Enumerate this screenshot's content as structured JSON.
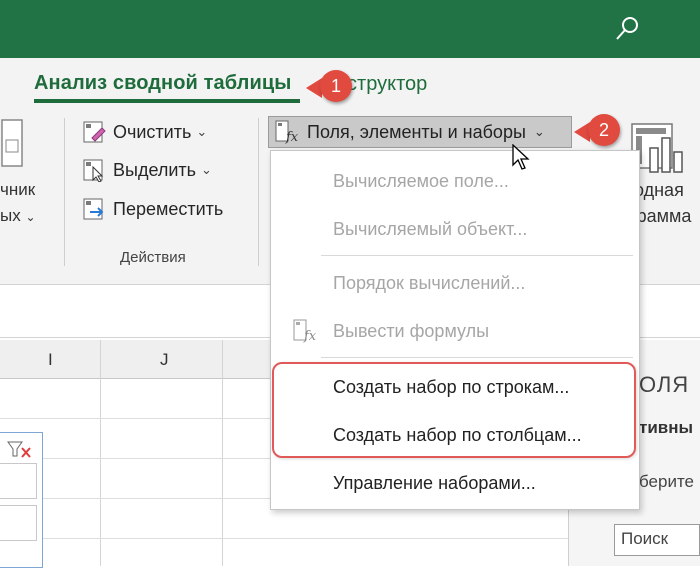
{
  "ribbon": {
    "tabs": [
      {
        "label": "Анализ сводной таблицы",
        "active": true
      },
      {
        "label": "нструктор",
        "active": false
      }
    ],
    "left_fragments": [
      "чник",
      "ых"
    ],
    "actions_group": {
      "label": "Действия",
      "buttons": [
        {
          "label": "Очистить",
          "icon": "clear-icon",
          "has_menu": true
        },
        {
          "label": "Выделить",
          "icon": "select-icon",
          "has_menu": true
        },
        {
          "label": "Переместить",
          "icon": "move-icon",
          "has_menu": false
        }
      ]
    },
    "fields_button": {
      "label": "Поля, элементы и наборы",
      "icon": "fx-fields-icon"
    },
    "right_fragments": [
      "одная",
      "граммa"
    ]
  },
  "callouts": [
    "1",
    "2"
  ],
  "dropdown": {
    "items": [
      {
        "label": "Вычисляемое поле...",
        "enabled": false
      },
      {
        "label": "Вычисляемый объект...",
        "enabled": false
      },
      {
        "label": "Порядок вычислений...",
        "enabled": false
      },
      {
        "label": "Вывести формулы",
        "enabled": false,
        "icon": "fx-formula-icon"
      },
      {
        "label": "Создать набор по строкам...",
        "enabled": true
      },
      {
        "label": "Создать набор по столбцам...",
        "enabled": true
      },
      {
        "label": "Управление наборами...",
        "enabled": true
      }
    ]
  },
  "grid": {
    "columns": [
      "I",
      "J"
    ]
  },
  "side_pane": {
    "title_fragment": "ОЛЯ",
    "tab_fragment": "тивны",
    "text_fragment": "берите",
    "search_placeholder": "Поиск"
  },
  "colors": {
    "accent": "#217346",
    "callout": "#e04a3f",
    "highlight": "#e05a5a"
  }
}
